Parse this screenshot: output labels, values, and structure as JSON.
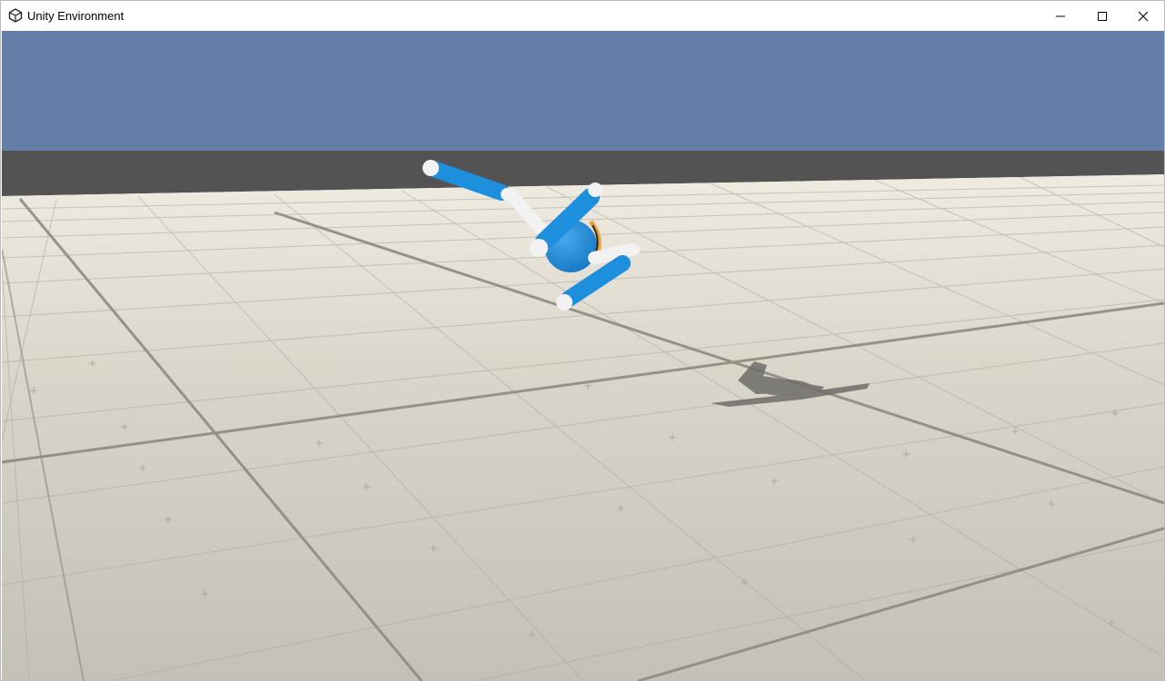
{
  "window": {
    "title": "Unity Environment",
    "icon": "unity-logo-icon",
    "controls": {
      "minimize": "minimize-icon",
      "maximize": "maximize-icon",
      "close": "close-icon"
    }
  },
  "scene": {
    "colors": {
      "sky": "#657ea7",
      "wall": "#535353",
      "floor": "#d2cec3",
      "grid_line": "#8e8a80",
      "agent_blue": "#1e8fdc",
      "agent_white": "#f2f2f2",
      "shadow": "#6f6d68"
    }
  }
}
